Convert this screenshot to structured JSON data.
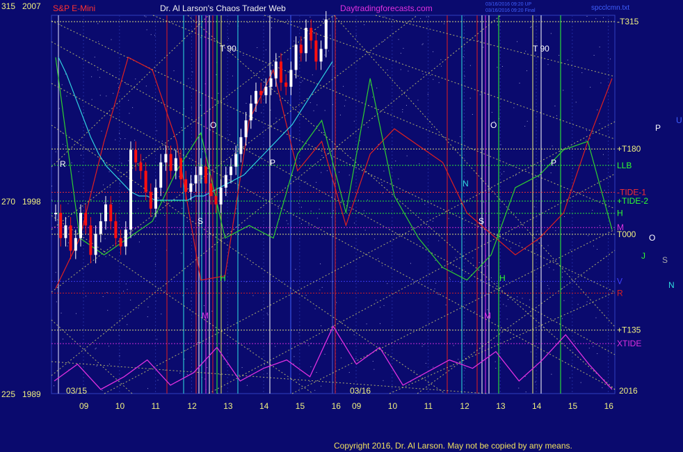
{
  "chart_data": {
    "type": "line",
    "header": {
      "y_top_label": "315",
      "year_top": "2007",
      "series_name": "S&P E-Mini",
      "title": "Dr. Al Larson's Chaos Trader Web",
      "site": "Daytradingforecasts.com",
      "stamp_1": "03/16/2016 09:20 UP",
      "stamp_2": "03/16/2016 09:20 Final",
      "file": "spcclcmn.txt"
    },
    "left_axis": [
      {
        "label": "315",
        "year": "2007",
        "value": 315
      },
      {
        "label": "270",
        "year": "1998",
        "value": 270
      },
      {
        "label": "225",
        "year": "1989",
        "value": 225
      }
    ],
    "date_labels": [
      "03/15",
      "03/16"
    ],
    "x_ticks": [
      "09",
      "10",
      "11",
      "12",
      "13",
      "14",
      "15",
      "16",
      "09",
      "10",
      "11",
      "12",
      "13",
      "14",
      "15",
      "16"
    ],
    "year_label": "2016",
    "price_bars": [
      268,
      262,
      265,
      259,
      262,
      268,
      265,
      258,
      263,
      266,
      270,
      266,
      262,
      260,
      264,
      283,
      280,
      278,
      273,
      269,
      274,
      280,
      282,
      278,
      281,
      276,
      273,
      275,
      277,
      279,
      275,
      272,
      270,
      274,
      277,
      279,
      282,
      286,
      290,
      294,
      297,
      296,
      298,
      300,
      304,
      299,
      298,
      302,
      308,
      306,
      312,
      309,
      304,
      307,
      314
    ],
    "cyan_curve": [
      305,
      301,
      296,
      291,
      286,
      282,
      279,
      277,
      275,
      273,
      272,
      272,
      271,
      271,
      271,
      271,
      271,
      272,
      272,
      273,
      274,
      275,
      276,
      277,
      279,
      281,
      283,
      285,
      287,
      289,
      292,
      295,
      298,
      301,
      304
    ],
    "forecast_lines": [
      {
        "name": "red",
        "color": "#e02020",
        "values": [
          250,
          262,
          285,
          305,
          302,
          285,
          252,
          253,
          290,
          302,
          278,
          285,
          265,
          282,
          288,
          284,
          280,
          268,
          263,
          258,
          262,
          268,
          285,
          300
        ]
      },
      {
        "name": "green",
        "color": "#30d030",
        "values": [
          305,
          262,
          258,
          262,
          266,
          278,
          287,
          262,
          265,
          262,
          282,
          290,
          268,
          300,
          272,
          262,
          255,
          252,
          258,
          274,
          277,
          283,
          285,
          264
        ]
      }
    ],
    "xtide": [
      228,
      232,
      226,
      229,
      233,
      227,
      230,
      236,
      228,
      231,
      233,
      229,
      241,
      232,
      236,
      227,
      230,
      233,
      231,
      235,
      228,
      233,
      239,
      232,
      226
    ],
    "levels": [
      {
        "label": "-T315",
        "color": "#f0f080",
        "value": 313.5
      },
      {
        "label": "+T180",
        "color": "#f0f080",
        "value": 283.2
      },
      {
        "label": "LLB",
        "color": "#30ff30",
        "value": 279.3
      },
      {
        "label": "-TIDE-1",
        "color": "#ff3030",
        "value": 272.9
      },
      {
        "label": "+TIDE-2",
        "color": "#30ff30",
        "value": 270.8
      },
      {
        "label": "H",
        "color": "#30ff30",
        "value": 267.9
      },
      {
        "label": "M",
        "color": "#e030e0",
        "value": 264.5
      },
      {
        "label": "T000",
        "color": "#f0f080",
        "value": 262.9
      },
      {
        "label": "V",
        "color": "#4040ff",
        "value": 251.7
      },
      {
        "label": "R",
        "color": "#e02020",
        "value": 248.9
      },
      {
        "label": "+T135",
        "color": "#f0f080",
        "value": 240.1
      },
      {
        "label": "XTIDE",
        "color": "#e030e0",
        "value": 236.9
      }
    ],
    "marker_letters": [
      {
        "text": "R",
        "color": "#ffffff"
      },
      {
        "text": "T 90",
        "color": "#ffffff"
      },
      {
        "text": "O",
        "color": "#ffffff"
      },
      {
        "text": "P",
        "color": "#ffffff"
      },
      {
        "text": "S",
        "color": "#ffffff"
      },
      {
        "text": "H",
        "color": "#30ff30"
      },
      {
        "text": "M",
        "color": "#e030e0"
      },
      {
        "text": "O",
        "color": "#ffffff"
      },
      {
        "text": "T 90",
        "color": "#ffffff"
      },
      {
        "text": "P",
        "color": "#ffffff"
      },
      {
        "text": "N",
        "color": "#30e0e0"
      },
      {
        "text": "S",
        "color": "#ffffff"
      },
      {
        "text": "H",
        "color": "#30ff30"
      },
      {
        "text": "M",
        "color": "#e030e0"
      },
      {
        "text": "P",
        "color": "#ffffff"
      },
      {
        "text": "U",
        "color": "#4060ff"
      },
      {
        "text": "O",
        "color": "#ffffff"
      },
      {
        "text": "J",
        "color": "#30ff30"
      },
      {
        "text": "S",
        "color": "#aaaaaa"
      },
      {
        "text": "N",
        "color": "#30e0e0"
      }
    ],
    "copyright": "Copyright 2016, Dr. Al Larson. May not be copied by any means.",
    "ylim": [
      225,
      315
    ],
    "colors": {
      "background": "#0a0a6e",
      "up_bar": "#ffffff",
      "down_bar": "#ff1010",
      "axis_text": "#f0f080",
      "title": "#f0f0f0",
      "series_name": "#ff3030",
      "site": "#e030e0"
    }
  }
}
